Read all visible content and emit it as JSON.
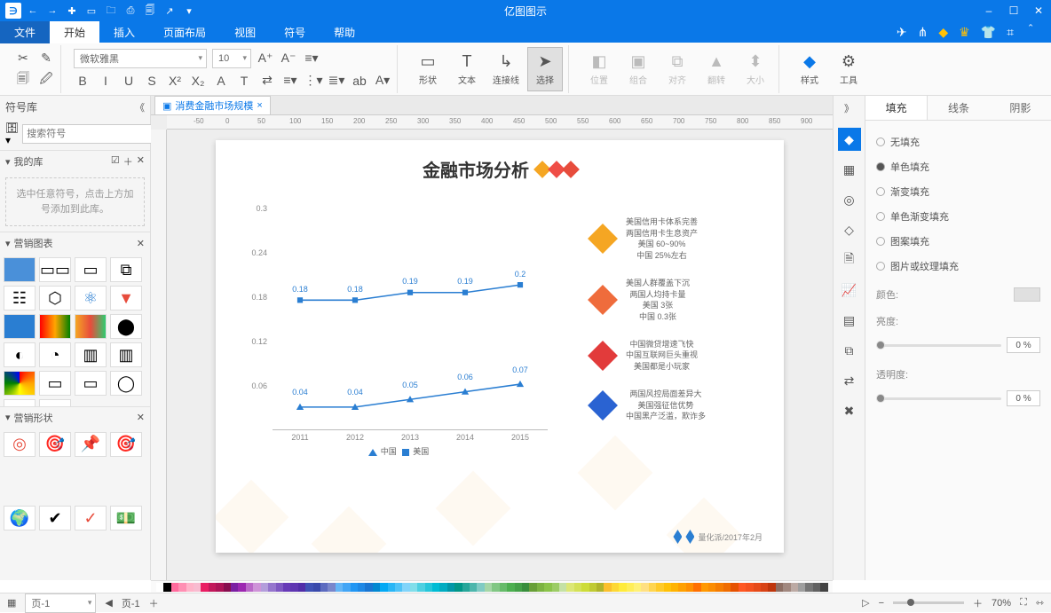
{
  "app_title": "亿图图示",
  "qat": [
    "←",
    "→",
    "✚",
    "▭",
    "🗀",
    "⎙",
    "🗐",
    "↗",
    "▾"
  ],
  "win_controls": [
    "–",
    "☐",
    "✕"
  ],
  "menu": {
    "file": "文件",
    "start": "开始",
    "insert": "插入",
    "layout": "页面布局",
    "view": "视图",
    "symbol": "符号",
    "help": "帮助"
  },
  "menu_right_icons": [
    "✈",
    "⋔",
    "◆",
    "♛",
    "👕",
    "⌗",
    "＾"
  ],
  "ribbon": {
    "font_name": "微软雅黑",
    "font_size": "10",
    "clipboard": [
      "✂",
      "✎",
      "🗐",
      "🖉"
    ],
    "text_tools": [
      "B",
      "I",
      "U",
      "S",
      "X²",
      "X₂",
      "A",
      "T",
      "⇄",
      "≡",
      "⋮",
      "≣",
      "ab",
      "A▾"
    ],
    "big": {
      "shape": "形状",
      "text": "文本",
      "connector": "连接线",
      "select": "选择",
      "position": "位置",
      "group": "组合",
      "align": "对齐",
      "flip": "翻转",
      "size": "大小",
      "style": "样式",
      "tool": "工具"
    },
    "big_icons": {
      "shape": "▭",
      "text": "T",
      "connector": "↳",
      "select": "➤",
      "position": "◧",
      "group": "▣",
      "align": "⧉",
      "flip": "▲",
      "size": "⬍",
      "style": "◆",
      "tool": "⚙"
    }
  },
  "left": {
    "title": "符号库",
    "search_placeholder": "搜索符号",
    "mylib": "我的库",
    "mylib_tools": [
      "☑",
      "＋",
      "✕"
    ],
    "hint": "选中任意符号，点击上方加号添加到此库。",
    "sec_chart": "营销图表",
    "sec_shape": "营销形状"
  },
  "doc_tab": "消费金融市场规模",
  "ruler_ticks": [
    -50,
    0,
    50,
    100,
    150,
    200,
    250,
    300,
    350,
    400,
    450,
    500,
    550,
    600,
    650,
    700,
    750,
    800,
    850,
    900
  ],
  "page": {
    "title": "金融市场分析",
    "footer": "量化派/2017年2月",
    "legend_china": "中国",
    "legend_us": "美国",
    "side": [
      {
        "lines": [
          "美国信用卡体系完善",
          "两国信用卡生息资产",
          "美国 60~90%",
          "中国 25%左右"
        ]
      },
      {
        "lines": [
          "美国人群覆盖下沉",
          "两国人均持卡量",
          "美国 3张",
          "中国 0.3张"
        ]
      },
      {
        "lines": [
          "中国微贷增速飞快",
          "中国互联网巨头重视",
          "美国都是小玩家"
        ]
      },
      {
        "lines": [
          "两国风控局面差异大",
          "美国强征信优势",
          "中国黑产泛滥，欺诈多"
        ]
      }
    ]
  },
  "chart_data": {
    "type": "line",
    "categories": [
      "2011",
      "2012",
      "2013",
      "2014",
      "2015"
    ],
    "series": [
      {
        "name": "中国",
        "values": [
          0.04,
          0.04,
          0.05,
          0.06,
          0.07
        ]
      },
      {
        "name": "美国",
        "values": [
          0.18,
          0.18,
          0.19,
          0.19,
          0.2
        ]
      }
    ],
    "ylim": [
      0,
      0.3
    ],
    "yticks": [
      0.06,
      0.12,
      0.18,
      0.24,
      0.3
    ],
    "title": "",
    "xlabel": "",
    "ylabel": ""
  },
  "rstrip_icons": [
    "◆",
    "▦",
    "◎",
    "◇",
    "🗎",
    "📈",
    "▤",
    "⧉",
    "⇄",
    "✖"
  ],
  "rpanel": {
    "tabs": {
      "fill": "填充",
      "line": "线条",
      "shadow": "阴影"
    },
    "opts": {
      "none": "无填充",
      "solid": "单色填充",
      "gradient": "渐变填充",
      "solid_grad": "单色渐变填充",
      "pattern": "图案填充",
      "texture": "图片或纹理填充"
    },
    "color_label": "颜色:",
    "brightness": "亮度:",
    "opacity": "透明度:",
    "zero": "0 %"
  },
  "status": {
    "page_combo": "页-1",
    "page_label": "页-1",
    "zoom": "70%"
  }
}
